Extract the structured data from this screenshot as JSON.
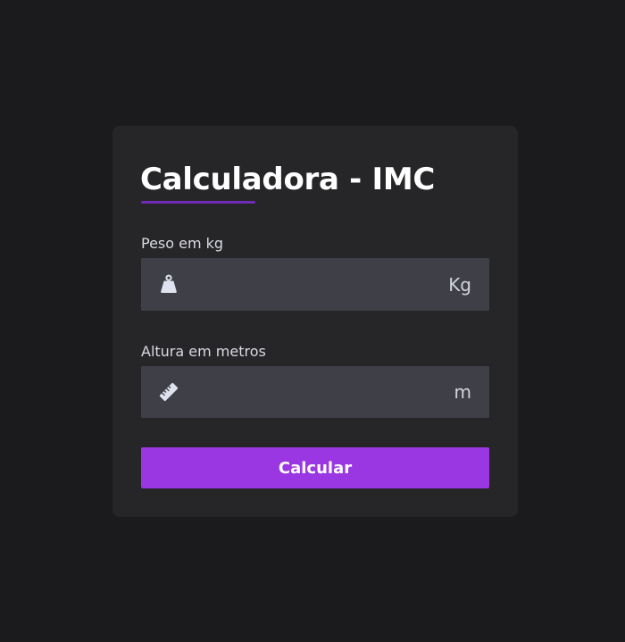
{
  "form": {
    "title": "Calculadora - IMC",
    "accent_color": "#6f2bb5",
    "button_color": "#9b37e2",
    "weight": {
      "label": "Peso em kg",
      "unit": "Kg",
      "value": "",
      "placeholder": "",
      "icon": "weight-icon"
    },
    "height": {
      "label": "Altura em metros",
      "unit": "m",
      "value": "",
      "placeholder": "",
      "icon": "ruler-icon"
    },
    "submit_label": "Calcular"
  }
}
